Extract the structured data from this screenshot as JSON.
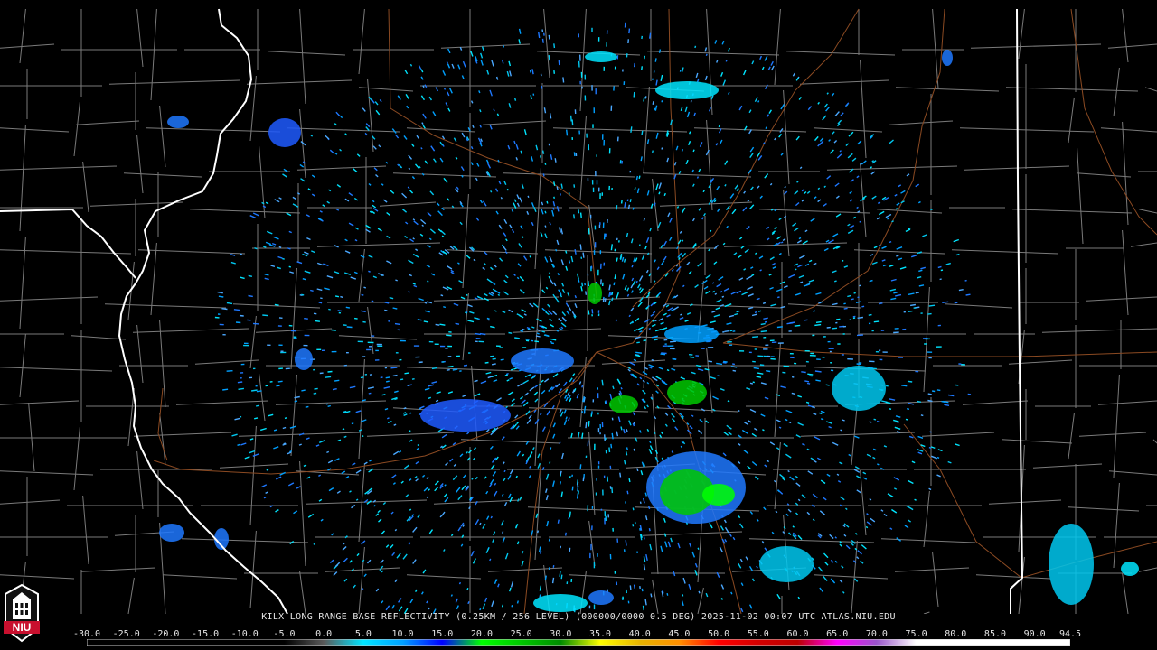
{
  "product": {
    "caption": "KILX LONG RANGE BASE REFLECTIVITY (0.25KM / 256 LEVEL) (000000/0000 0.5 DEG) 2025-11-02 00:07 UTC  ATLAS.NIU.EDU"
  },
  "logo": {
    "text": "NIU",
    "icon": "niu-logo-icon"
  },
  "colors": {
    "state_border": "#ffffff",
    "county_border": "#7a7a7a",
    "highway": "#8b4a22",
    "background": "#000000"
  },
  "color_scale": {
    "labels": [
      "-30.0",
      "-25.0",
      "-20.0",
      "-15.0",
      "-10.0",
      "-5.0",
      "0.0",
      "5.0",
      "10.0",
      "15.0",
      "20.0",
      "25.0",
      "30.0",
      "35.0",
      "40.0",
      "45.0",
      "50.0",
      "55.0",
      "60.0",
      "65.0",
      "70.0",
      "75.0",
      "80.0",
      "85.0",
      "90.0",
      "94.5"
    ],
    "min": -30.0,
    "max": 94.5,
    "stops": [
      {
        "value": -30.0,
        "color": "#000000"
      },
      {
        "value": -5.0,
        "color": "#000000"
      },
      {
        "value": 0.0,
        "color": "#5a5a5a"
      },
      {
        "value": 5.0,
        "color": "#00e5ff"
      },
      {
        "value": 10.0,
        "color": "#00a0ff"
      },
      {
        "value": 15.0,
        "color": "#0000ff"
      },
      {
        "value": 20.0,
        "color": "#00ff00"
      },
      {
        "value": 25.0,
        "color": "#00c800"
      },
      {
        "value": 30.0,
        "color": "#008c00"
      },
      {
        "value": 35.0,
        "color": "#ffff00"
      },
      {
        "value": 40.0,
        "color": "#e6b400"
      },
      {
        "value": 45.0,
        "color": "#ff9000"
      },
      {
        "value": 50.0,
        "color": "#ff0000"
      },
      {
        "value": 55.0,
        "color": "#d40000"
      },
      {
        "value": 60.0,
        "color": "#bc0000"
      },
      {
        "value": 65.0,
        "color": "#ff00ff"
      },
      {
        "value": 70.0,
        "color": "#9955c9"
      },
      {
        "value": 75.0,
        "color": "#ffffff"
      },
      {
        "value": 94.5,
        "color": "#ffffff"
      }
    ]
  }
}
